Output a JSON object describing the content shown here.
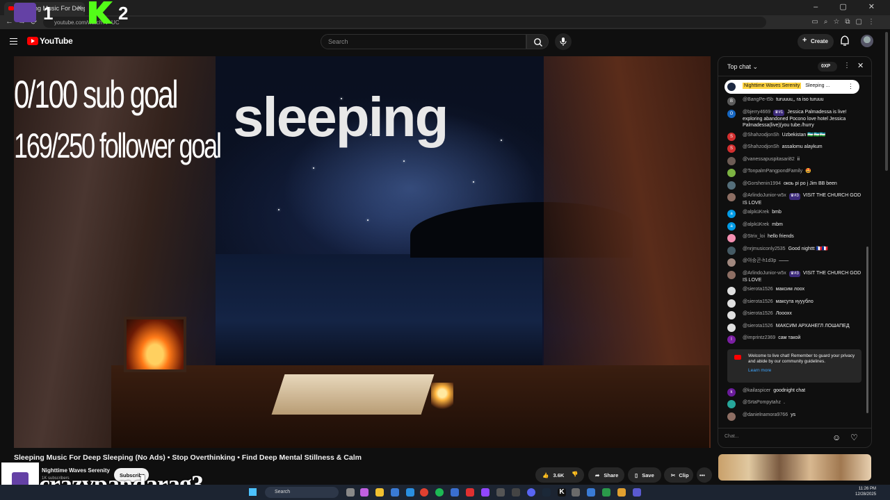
{
  "browser": {
    "tab_title": "Sleeping Music For Deep Sl",
    "url": "youtube.com/watch?v=UC",
    "new_tab": "+",
    "window_controls": "– ▢ ✕"
  },
  "stream_overlay": {
    "number_1": "1",
    "number_2": "2",
    "sub_goal": "0/100 sub goal",
    "follower_goal": "169/250 follower goal",
    "status_text": "sleeping",
    "watermark": "crazypandarag3"
  },
  "youtube": {
    "logo": "YouTube",
    "search_placeholder": "Search",
    "create_label": "Create"
  },
  "chat": {
    "title": "Top chat",
    "xp": "0XP",
    "pinned": {
      "channel": "Nighttime Waves Serenity",
      "text": "Sleeping ..."
    },
    "messages": [
      {
        "author": "@BangPe-t5b",
        "text": "turuuuu,, ra iso turuuu",
        "avatar": "B",
        "color": "#5c5c5c"
      },
      {
        "author": "@bjerry4669",
        "badge": "#1",
        "text": "Jessica Palmadessa is live! exploring abandoned Pocono love hotel Jessica Palmadessa(live)(you tube./hurry",
        "avatar": "O",
        "color": "#1565c0"
      },
      {
        "author": "@ShahzodjonSh",
        "text": "Uzbekistan 🇺🇿🇺🇿🇺🇿",
        "avatar": "S",
        "color": "#d32f2f"
      },
      {
        "author": "@ShahzodjonSh",
        "text": "assalomu alaykum",
        "avatar": "S",
        "color": "#d32f2f"
      },
      {
        "author": "@vanessapuspitasari82",
        "text": "ii",
        "avatar": "",
        "color": "#6d5c55"
      },
      {
        "author": "@TonpalmPangpondFamily",
        "text": "🤩",
        "avatar": "",
        "color": "#7cb342"
      },
      {
        "author": "@Gorshenin1994",
        "text": "окоь pi po j Jim BB been",
        "avatar": "",
        "color": "#546e7a"
      },
      {
        "author": "@ArlindoJunior-w5x",
        "badge": "#3",
        "text": "VISIT THE CHURCH GOD IS LOVE",
        "avatar": "",
        "color": "#8d6e63"
      },
      {
        "author": "@alpküKrek",
        "text": "bmb",
        "avatar": "a",
        "color": "#039be5"
      },
      {
        "author": "@alpküKrek",
        "text": "mbm",
        "avatar": "a",
        "color": "#039be5"
      },
      {
        "author": "@Strix_loi",
        "text": "hello friends",
        "avatar": "",
        "color": "#f48fb1"
      },
      {
        "author": "@nrjmusiconly2535",
        "text": "Good nighttt 🇫🇷🇫🇷",
        "avatar": "",
        "color": "#455a64"
      },
      {
        "author": "@아승곤-h1d3p",
        "text": "——",
        "avatar": "",
        "color": "#a1887f"
      },
      {
        "author": "@ArlindoJunior-w5x",
        "badge": "#3",
        "text": "VISIT THE CHURCH GOD IS LOVE",
        "avatar": "",
        "color": "#8d6e63"
      },
      {
        "author": "@sierota1526",
        "text": "максим лоох",
        "avatar": "",
        "color": "#e0e0e0"
      },
      {
        "author": "@sierota1526",
        "text": "максута нуууб​ло",
        "avatar": "",
        "color": "#e0e0e0"
      },
      {
        "author": "@sierota1526",
        "text": "Лооохх",
        "avatar": "",
        "color": "#e0e0e0"
      },
      {
        "author": "@sierota1526",
        "text": "МАКСИМ АРХАНЕГЛ ЛОШАПЕД",
        "avatar": "",
        "color": "#e0e0e0"
      },
      {
        "author": "@imprintz2369",
        "text": "сам такой",
        "avatar": "I",
        "color": "#7b1fa2"
      }
    ],
    "notice": {
      "text": "Welcome to live chat! Remember to guard your privacy and abide by our community guidelines.",
      "link": "Learn more"
    },
    "messages_after": [
      {
        "author": "@kailaspicer",
        "text": "goodnight chat",
        "avatar": "k",
        "color": "#6a1b9a"
      },
      {
        "author": "@SrtaPompytahz",
        "text": ".",
        "avatar": "",
        "color": "#26a69a"
      },
      {
        "author": "@danielnamora9766",
        "text": "ys",
        "avatar": "",
        "color": "#8d6e63"
      }
    ],
    "input_placeholder": "Chat..."
  },
  "video": {
    "title": "Sleeping Music For Deep Sleeping (No Ads) • Stop Overthinking • Find Deep Mental Stillness & Calm",
    "channel": "Nighttime Waves Serenity",
    "subscribers": "1K subscribers",
    "subscribe_label": "Subscribe",
    "likes": "3.6K",
    "share_label": "Share",
    "save_label": "Save",
    "clip_label": "Clip",
    "more": "•••"
  },
  "taskbar": {
    "search_label": "Search",
    "time": "11:26 PM",
    "date": "12/28/2025"
  }
}
